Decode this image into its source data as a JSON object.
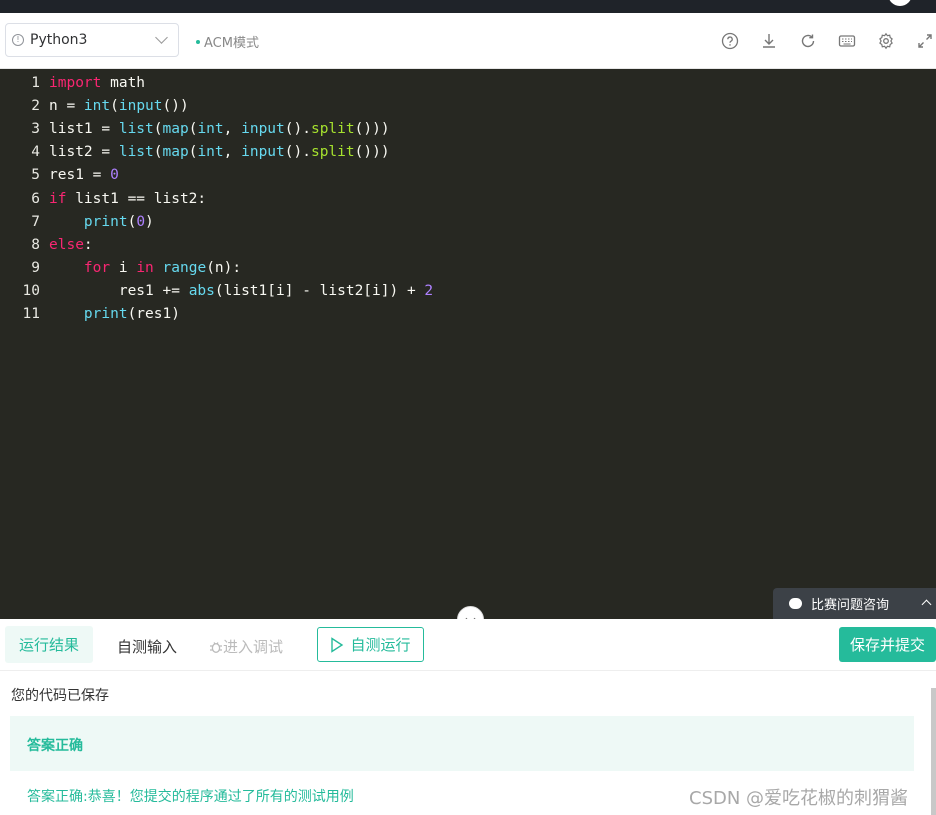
{
  "toolbar": {
    "language": "Python3",
    "mode": "ACM模式",
    "icons": [
      "help-icon",
      "download-icon",
      "refresh-icon",
      "keyboard-icon",
      "gear-icon",
      "fullscreen-icon"
    ]
  },
  "editor": {
    "lines": [
      {
        "n": "1"
      },
      {
        "n": "2"
      },
      {
        "n": "3"
      },
      {
        "n": "4"
      },
      {
        "n": "5"
      },
      {
        "n": "6"
      },
      {
        "n": "7"
      },
      {
        "n": "8"
      },
      {
        "n": "9"
      },
      {
        "n": "10"
      },
      {
        "n": "11"
      }
    ],
    "code": [
      [
        [
          "kw",
          "import"
        ],
        [
          "t",
          " math"
        ]
      ],
      [
        [
          "t",
          "n = "
        ],
        [
          "bi",
          "int"
        ],
        [
          "t",
          "("
        ],
        [
          "bi",
          "input"
        ],
        [
          "t",
          "())"
        ]
      ],
      [
        [
          "t",
          "list1 = "
        ],
        [
          "bi",
          "list"
        ],
        [
          "t",
          "("
        ],
        [
          "bi",
          "map"
        ],
        [
          "t",
          "("
        ],
        [
          "bi",
          "int"
        ],
        [
          "t",
          ", "
        ],
        [
          "bi",
          "input"
        ],
        [
          "t",
          "()."
        ],
        [
          "fn",
          "split"
        ],
        [
          "t",
          "()))"
        ]
      ],
      [
        [
          "t",
          "list2 = "
        ],
        [
          "bi",
          "list"
        ],
        [
          "t",
          "("
        ],
        [
          "bi",
          "map"
        ],
        [
          "t",
          "("
        ],
        [
          "bi",
          "int"
        ],
        [
          "t",
          ", "
        ],
        [
          "bi",
          "input"
        ],
        [
          "t",
          "()."
        ],
        [
          "fn",
          "split"
        ],
        [
          "t",
          "()))"
        ]
      ],
      [
        [
          "t",
          "res1 = "
        ],
        [
          "num",
          "0"
        ]
      ],
      [
        [
          "kw",
          "if"
        ],
        [
          "t",
          " list1 == list2:"
        ]
      ],
      [
        [
          "t",
          "    "
        ],
        [
          "bi",
          "print"
        ],
        [
          "t",
          "("
        ],
        [
          "num",
          "0"
        ],
        [
          "t",
          ")"
        ]
      ],
      [
        [
          "kw",
          "else"
        ],
        [
          "t",
          ":"
        ]
      ],
      [
        [
          "t",
          "    "
        ],
        [
          "kw",
          "for"
        ],
        [
          "t",
          " i "
        ],
        [
          "kw",
          "in"
        ],
        [
          "t",
          " "
        ],
        [
          "bi",
          "range"
        ],
        [
          "t",
          "(n):"
        ]
      ],
      [
        [
          "t",
          "        res1 += "
        ],
        [
          "bi",
          "abs"
        ],
        [
          "t",
          "(list1[i] - list2[i]) + "
        ],
        [
          "num",
          "2"
        ]
      ],
      [
        [
          "t",
          "    "
        ],
        [
          "bi",
          "print"
        ],
        [
          "t",
          "(res1)"
        ]
      ]
    ]
  },
  "consult": {
    "label": "比赛问题咨询"
  },
  "actions": {
    "tab_result": "运行结果",
    "tab_input": "自测输入",
    "tab_debug": "进入调试",
    "run_label": "自测运行",
    "submit_label": "保存并提交"
  },
  "result": {
    "saved": "您的代码已保存",
    "status": "答案正确",
    "detail": "答案正确:恭喜！您提交的程序通过了所有的测试用例"
  },
  "watermark": "CSDN @爱吃花椒的刺猬酱",
  "colors": {
    "accent": "#25bb9b",
    "editor_bg": "#272822",
    "keyword": "#f92672",
    "builtin": "#66d9ef",
    "method": "#a6e22e",
    "number": "#ae81ff"
  }
}
